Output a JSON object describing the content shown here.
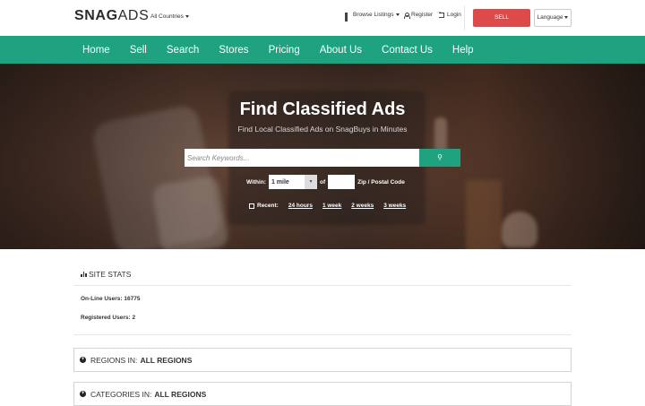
{
  "header": {
    "logo_bold": "SNAG",
    "logo_thin": "ADS",
    "country_select": "All Countries",
    "browse_listings": "Browse Listings",
    "register": "Register",
    "login": "Login",
    "sell_button": "SELL",
    "language_button": "Language"
  },
  "nav": {
    "items": [
      "Home",
      "Sell",
      "Search",
      "Stores",
      "Pricing",
      "About Us",
      "Contact Us",
      "Help"
    ]
  },
  "hero": {
    "title": "Find Classified Ads",
    "subtitle": "Find Local Classified Ads on SnagBuys in Minutes",
    "search_placeholder": "Search Keywords...",
    "search_button_icon": "search-icon",
    "within_label": "Within:",
    "within_value": "1 mile",
    "of_label": "of",
    "zip_label": "Zip / Postal Code",
    "recent_label": "Recent:",
    "recent_links": [
      "24 hours",
      "1 week",
      "2 weeks",
      "3 weeks"
    ]
  },
  "stats": {
    "title_prefix": "SITE",
    "title_suffix": "STATS",
    "online_users": "On-Line Users: 16775",
    "registered_users": "Registered Users: 2"
  },
  "panels": {
    "regions_prefix": "REGIONS IN:",
    "regions_value": "ALL REGIONS",
    "categories_prefix": "CATEGORIES IN:",
    "categories_value": "ALL REGIONS"
  },
  "colors": {
    "accent_green": "#1fa27f",
    "sell_red": "#dc4a4a"
  }
}
